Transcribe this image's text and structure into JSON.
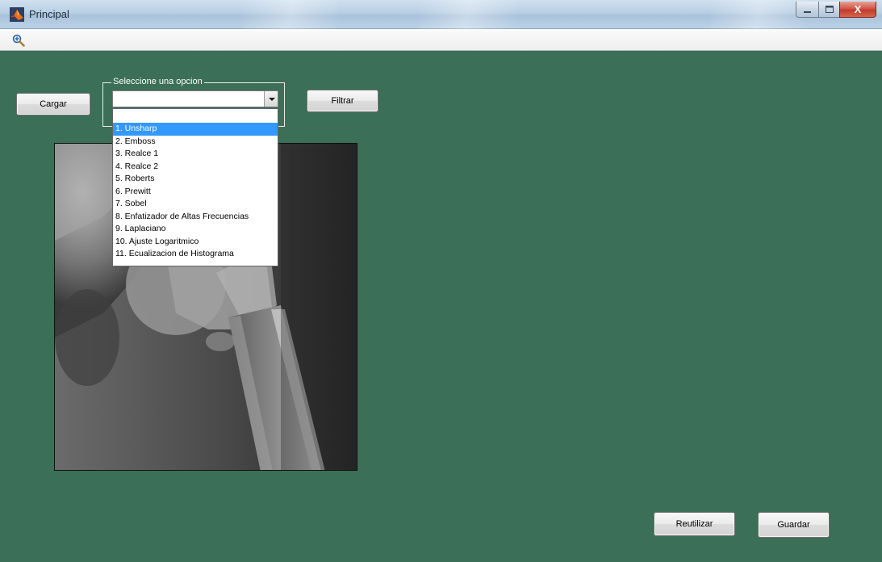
{
  "window": {
    "title": "Principal",
    "controls": {
      "minimize": "—",
      "maximize": "☐",
      "close": "X"
    }
  },
  "toolbar": {
    "zoom_icon": "zoom-in-icon"
  },
  "buttons": {
    "cargar": "Cargar",
    "filtrar": "Filtrar",
    "reutilizar": "Reutilizar",
    "guardar": "Guardar"
  },
  "group": {
    "label": "Seleccione una opcion",
    "selected_value": ""
  },
  "dropdown": {
    "options": [
      "",
      "1. Unsharp",
      "2. Emboss",
      "3. Realce 1",
      "4. Realce 2",
      "5. Roberts",
      "6. Prewitt",
      "7. Sobel",
      "8. Enfatizador de Altas Frecuencias",
      "9. Laplaciano",
      "10. Ajuste Logaritmico",
      "11. Ecualizacion de Histograma"
    ],
    "highlighted_index": 1
  },
  "colors": {
    "background": "#3b6f57",
    "highlight": "#3399ff"
  }
}
